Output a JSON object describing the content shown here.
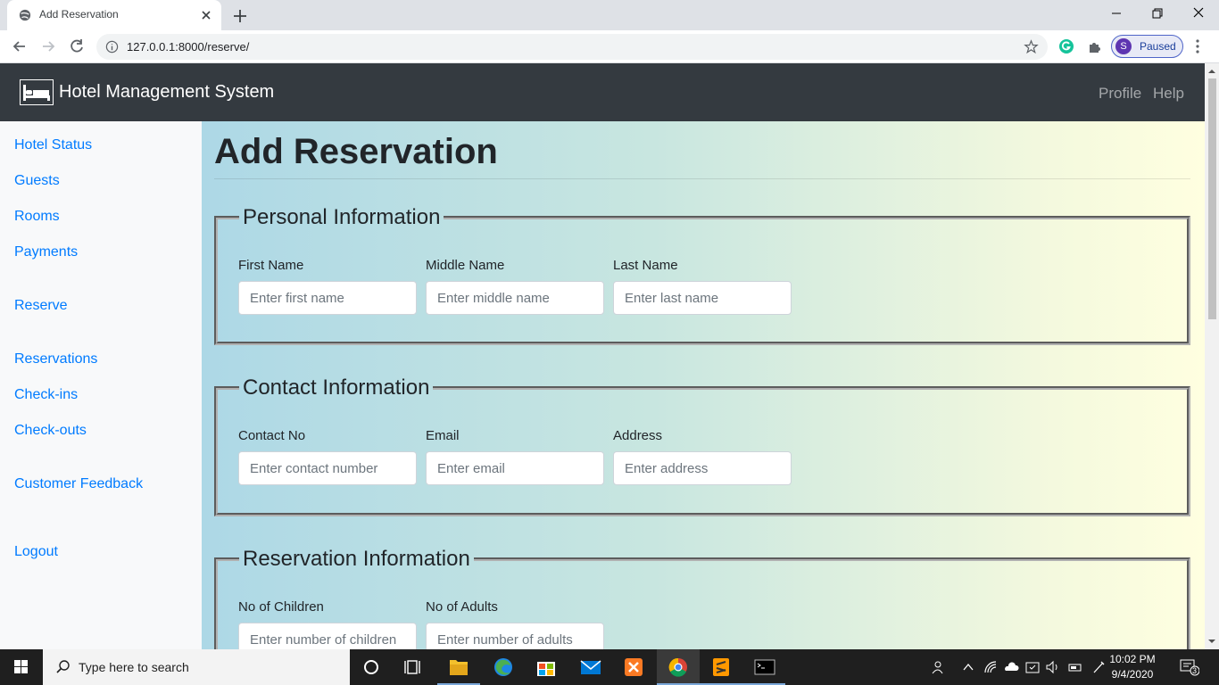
{
  "browser": {
    "tab_title": "Add Reservation",
    "url": "127.0.0.1:8000/reserve/",
    "profile_initial": "S",
    "profile_status": "Paused"
  },
  "app": {
    "brand": "Hotel Management System",
    "nav_right": [
      "Profile",
      "Help"
    ],
    "sidebar": [
      "Hotel Status",
      "Guests",
      "Rooms",
      "Payments",
      "Reserve",
      "Reservations",
      "Check-ins",
      "Check-outs",
      "Customer Feedback",
      "Logout"
    ]
  },
  "page": {
    "title": "Add Reservation",
    "sections": {
      "personal": {
        "legend": "Personal Information",
        "fields": [
          {
            "label": "First Name",
            "placeholder": "Enter first name"
          },
          {
            "label": "Middle Name",
            "placeholder": "Enter middle name"
          },
          {
            "label": "Last Name",
            "placeholder": "Enter last name"
          }
        ]
      },
      "contact": {
        "legend": "Contact Information",
        "fields": [
          {
            "label": "Contact No",
            "placeholder": "Enter contact number"
          },
          {
            "label": "Email",
            "placeholder": "Enter email"
          },
          {
            "label": "Address",
            "placeholder": "Enter address"
          }
        ]
      },
      "reservation": {
        "legend": "Reservation Information",
        "fields": [
          {
            "label": "No of Children",
            "placeholder": "Enter number of children"
          },
          {
            "label": "No of Adults",
            "placeholder": "Enter number of adults"
          }
        ]
      }
    }
  },
  "taskbar": {
    "search_placeholder": "Type here to search",
    "time": "10:02 PM",
    "date": "9/4/2020",
    "notification_count": "3"
  },
  "colors": {
    "navbar": "#343a40",
    "link": "#007bff",
    "sidebar": "#f8f9fa"
  }
}
